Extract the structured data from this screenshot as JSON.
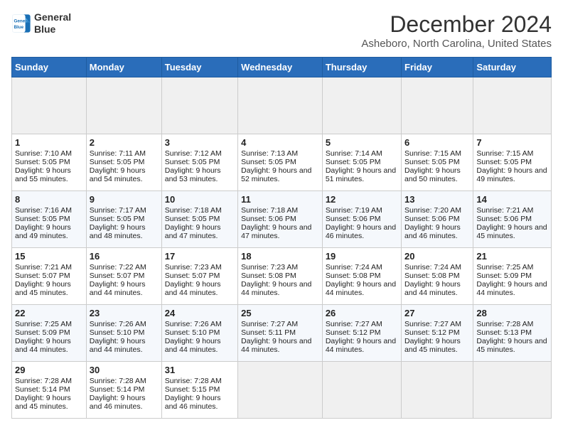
{
  "header": {
    "logo_line1": "General",
    "logo_line2": "Blue",
    "main_title": "December 2024",
    "subtitle": "Asheboro, North Carolina, United States"
  },
  "calendar": {
    "days_of_week": [
      "Sunday",
      "Monday",
      "Tuesday",
      "Wednesday",
      "Thursday",
      "Friday",
      "Saturday"
    ],
    "weeks": [
      [
        {
          "day": "",
          "empty": true
        },
        {
          "day": "",
          "empty": true
        },
        {
          "day": "",
          "empty": true
        },
        {
          "day": "",
          "empty": true
        },
        {
          "day": "",
          "empty": true
        },
        {
          "day": "",
          "empty": true
        },
        {
          "day": "",
          "empty": true
        }
      ],
      [
        {
          "day": "1",
          "sunrise": "7:10 AM",
          "sunset": "5:05 PM",
          "daylight": "9 hours and 55 minutes."
        },
        {
          "day": "2",
          "sunrise": "7:11 AM",
          "sunset": "5:05 PM",
          "daylight": "9 hours and 54 minutes."
        },
        {
          "day": "3",
          "sunrise": "7:12 AM",
          "sunset": "5:05 PM",
          "daylight": "9 hours and 53 minutes."
        },
        {
          "day": "4",
          "sunrise": "7:13 AM",
          "sunset": "5:05 PM",
          "daylight": "9 hours and 52 minutes."
        },
        {
          "day": "5",
          "sunrise": "7:14 AM",
          "sunset": "5:05 PM",
          "daylight": "9 hours and 51 minutes."
        },
        {
          "day": "6",
          "sunrise": "7:15 AM",
          "sunset": "5:05 PM",
          "daylight": "9 hours and 50 minutes."
        },
        {
          "day": "7",
          "sunrise": "7:15 AM",
          "sunset": "5:05 PM",
          "daylight": "9 hours and 49 minutes."
        }
      ],
      [
        {
          "day": "8",
          "sunrise": "7:16 AM",
          "sunset": "5:05 PM",
          "daylight": "9 hours and 49 minutes."
        },
        {
          "day": "9",
          "sunrise": "7:17 AM",
          "sunset": "5:05 PM",
          "daylight": "9 hours and 48 minutes."
        },
        {
          "day": "10",
          "sunrise": "7:18 AM",
          "sunset": "5:05 PM",
          "daylight": "9 hours and 47 minutes."
        },
        {
          "day": "11",
          "sunrise": "7:18 AM",
          "sunset": "5:06 PM",
          "daylight": "9 hours and 47 minutes."
        },
        {
          "day": "12",
          "sunrise": "7:19 AM",
          "sunset": "5:06 PM",
          "daylight": "9 hours and 46 minutes."
        },
        {
          "day": "13",
          "sunrise": "7:20 AM",
          "sunset": "5:06 PM",
          "daylight": "9 hours and 46 minutes."
        },
        {
          "day": "14",
          "sunrise": "7:21 AM",
          "sunset": "5:06 PM",
          "daylight": "9 hours and 45 minutes."
        }
      ],
      [
        {
          "day": "15",
          "sunrise": "7:21 AM",
          "sunset": "5:07 PM",
          "daylight": "9 hours and 45 minutes."
        },
        {
          "day": "16",
          "sunrise": "7:22 AM",
          "sunset": "5:07 PM",
          "daylight": "9 hours and 44 minutes."
        },
        {
          "day": "17",
          "sunrise": "7:23 AM",
          "sunset": "5:07 PM",
          "daylight": "9 hours and 44 minutes."
        },
        {
          "day": "18",
          "sunrise": "7:23 AM",
          "sunset": "5:08 PM",
          "daylight": "9 hours and 44 minutes."
        },
        {
          "day": "19",
          "sunrise": "7:24 AM",
          "sunset": "5:08 PM",
          "daylight": "9 hours and 44 minutes."
        },
        {
          "day": "20",
          "sunrise": "7:24 AM",
          "sunset": "5:08 PM",
          "daylight": "9 hours and 44 minutes."
        },
        {
          "day": "21",
          "sunrise": "7:25 AM",
          "sunset": "5:09 PM",
          "daylight": "9 hours and 44 minutes."
        }
      ],
      [
        {
          "day": "22",
          "sunrise": "7:25 AM",
          "sunset": "5:09 PM",
          "daylight": "9 hours and 44 minutes."
        },
        {
          "day": "23",
          "sunrise": "7:26 AM",
          "sunset": "5:10 PM",
          "daylight": "9 hours and 44 minutes."
        },
        {
          "day": "24",
          "sunrise": "7:26 AM",
          "sunset": "5:10 PM",
          "daylight": "9 hours and 44 minutes."
        },
        {
          "day": "25",
          "sunrise": "7:27 AM",
          "sunset": "5:11 PM",
          "daylight": "9 hours and 44 minutes."
        },
        {
          "day": "26",
          "sunrise": "7:27 AM",
          "sunset": "5:12 PM",
          "daylight": "9 hours and 44 minutes."
        },
        {
          "day": "27",
          "sunrise": "7:27 AM",
          "sunset": "5:12 PM",
          "daylight": "9 hours and 45 minutes."
        },
        {
          "day": "28",
          "sunrise": "7:28 AM",
          "sunset": "5:13 PM",
          "daylight": "9 hours and 45 minutes."
        }
      ],
      [
        {
          "day": "29",
          "sunrise": "7:28 AM",
          "sunset": "5:14 PM",
          "daylight": "9 hours and 45 minutes."
        },
        {
          "day": "30",
          "sunrise": "7:28 AM",
          "sunset": "5:14 PM",
          "daylight": "9 hours and 46 minutes."
        },
        {
          "day": "31",
          "sunrise": "7:28 AM",
          "sunset": "5:15 PM",
          "daylight": "9 hours and 46 minutes."
        },
        {
          "day": "",
          "empty": true
        },
        {
          "day": "",
          "empty": true
        },
        {
          "day": "",
          "empty": true
        },
        {
          "day": "",
          "empty": true
        }
      ]
    ]
  }
}
